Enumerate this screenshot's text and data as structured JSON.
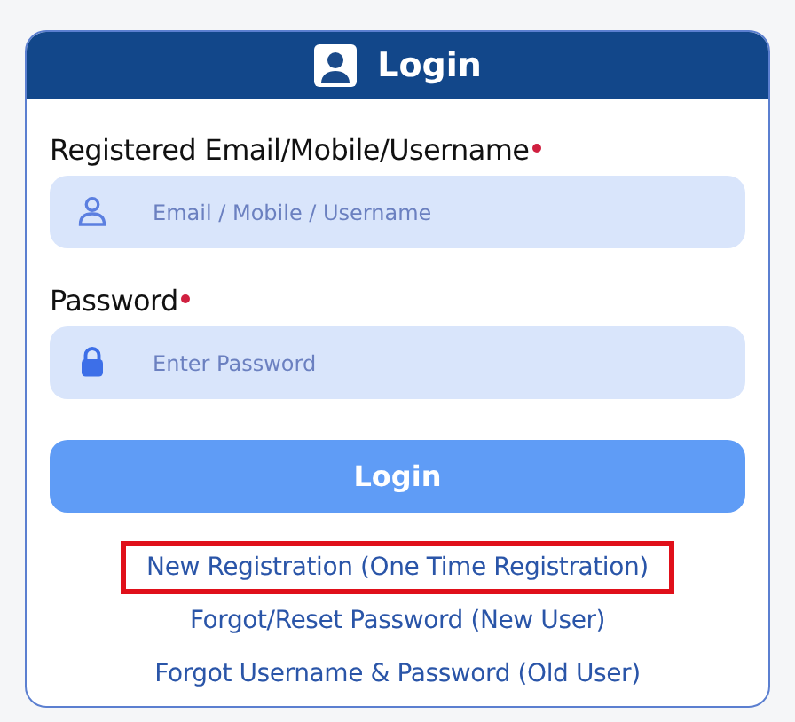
{
  "card": {
    "title": "Login"
  },
  "fields": [
    {
      "label": "Registered Email/Mobile/Username",
      "required": true,
      "kind": "user",
      "placeholder": "Email / Mobile / Username"
    },
    {
      "label": "Password",
      "required": true,
      "kind": "lock",
      "placeholder": "Enter Password"
    }
  ],
  "submit_button": "Login",
  "links": [
    {
      "text": "New Registration (One Time Registration)",
      "highlighted": true
    },
    {
      "text": "Forgot/Reset Password (New User)",
      "highlighted": false
    },
    {
      "text": "Forgot Username & Password (Old User)",
      "highlighted": false
    }
  ]
}
